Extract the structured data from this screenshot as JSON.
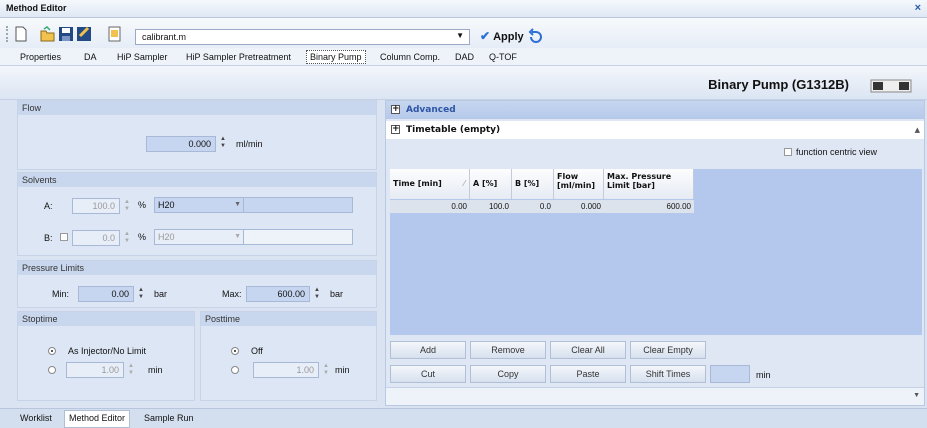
{
  "window": {
    "title": "Method Editor",
    "close": "×"
  },
  "toolbar": {
    "method_file": "calibrant.m",
    "apply_label": "Apply"
  },
  "tabs": [
    "Properties",
    "DA",
    "HiP Sampler",
    "HiP Sampler Pretreatment",
    "Binary Pump",
    "Column Comp.",
    "DAD",
    "Q-TOF"
  ],
  "active_tab": "Binary Pump",
  "module": {
    "title": "Binary Pump (G1312B)"
  },
  "flow": {
    "header": "Flow",
    "value": "0.000",
    "unit": "ml/min"
  },
  "solvents": {
    "header": "Solvents",
    "a": {
      "label": "A:",
      "value": "100.0",
      "pct": "%",
      "solvent": "H20"
    },
    "b": {
      "label": "B:",
      "value": "0.0",
      "pct": "%",
      "solvent": "H20"
    }
  },
  "pressure": {
    "header": "Pressure Limits",
    "min_label": "Min:",
    "min_value": "0.00",
    "max_label": "Max:",
    "max_value": "600.00",
    "unit": "bar"
  },
  "stoptime": {
    "header": "Stoptime",
    "option1": "As Injector/No Limit",
    "value": "1.00",
    "unit": "min"
  },
  "posttime": {
    "header": "Posttime",
    "option1": "Off",
    "value": "1.00",
    "unit": "min"
  },
  "advanced": {
    "label": "Advanced"
  },
  "timetable": {
    "label": "Timetable (empty)",
    "function_view": "function centric view",
    "columns": [
      "Time [min]",
      "A [%]",
      "B [%]",
      "Flow\n[ml/min]",
      "Max. Pressure\nLimit [bar]"
    ],
    "row": [
      "0.00",
      "100.0",
      "0.0",
      "0.000",
      "600.00"
    ]
  },
  "buttons": {
    "add": "Add",
    "remove": "Remove",
    "clear_all": "Clear All",
    "clear_empty": "Clear Empty",
    "cut": "Cut",
    "copy": "Copy",
    "paste": "Paste",
    "shift_times": "Shift Times",
    "shift_unit": "min"
  },
  "bottom_tabs": [
    "Worklist",
    "Method Editor",
    "Sample Run"
  ],
  "active_bottom_tab": "Method Editor"
}
